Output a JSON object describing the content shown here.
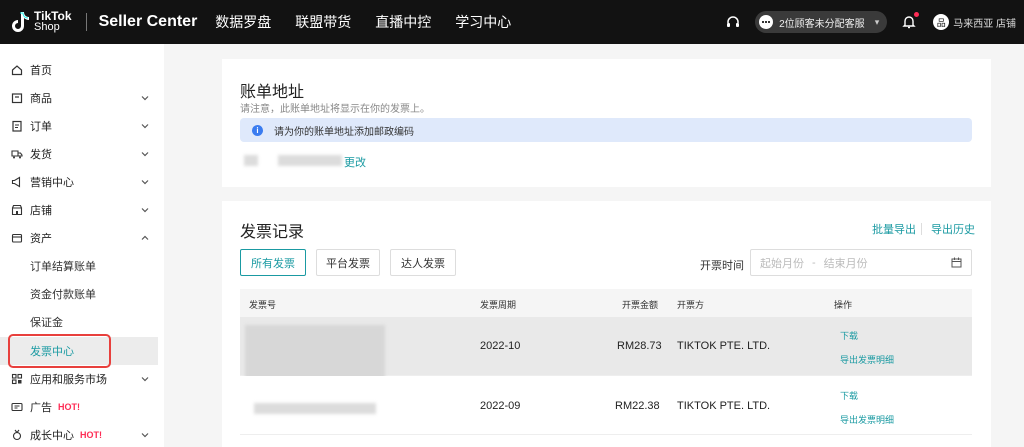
{
  "topbar": {
    "logo_main": "TikTok",
    "logo_sub": "Shop",
    "brand": "Seller Center",
    "nav": [
      "数据罗盘",
      "联盟带货",
      "直播中控",
      "学习中心"
    ],
    "cs_status": "2位顾客未分配客服",
    "shop_avatar_glyph": "品",
    "shop_name": "马来西亚 店铺"
  },
  "sidebar": {
    "items": [
      {
        "label": "首页",
        "icon": "home-icon"
      },
      {
        "label": "商品",
        "icon": "product-box-icon"
      },
      {
        "label": "订单",
        "icon": "order-clipboard-icon"
      },
      {
        "label": "发货",
        "icon": "delivery-truck-icon"
      },
      {
        "label": "营销中心",
        "icon": "megaphone-icon"
      },
      {
        "label": "店铺",
        "icon": "store-icon"
      },
      {
        "label": "资产",
        "icon": "wallet-icon"
      }
    ],
    "sub_items": [
      "订单结算账单",
      "资金付款账单",
      "保证金",
      "发票中心"
    ],
    "bottom_items": [
      {
        "label": "应用和服务市场",
        "icon": "apps-grid-icon",
        "hot": ""
      },
      {
        "label": "广告",
        "icon": "ads-screen-icon",
        "hot": "HOT!"
      },
      {
        "label": "成长中心",
        "icon": "growth-medal-icon",
        "hot": "HOT!"
      }
    ]
  },
  "billing": {
    "title": "账单地址",
    "subtitle": "请注意，此账单地址将显示在你的发票上。",
    "info": "请为你的账单地址添加邮政编码",
    "edit_link": "更改"
  },
  "invoices": {
    "title": "发票记录",
    "bulk_export": "批量导出",
    "export_history": "导出历史",
    "tabs": [
      "所有发票",
      "平台发票",
      "达人发票"
    ],
    "date_label": "开票时间",
    "date_start_placeholder": "起始月份",
    "date_sep": "-",
    "date_end_placeholder": "结束月份",
    "columns": [
      "发票号",
      "发票周期",
      "开票金额",
      "开票方",
      "操作"
    ],
    "rows": [
      {
        "period": "2022-10",
        "amount": "RM28.73",
        "issuer": "TIKTOK PTE. LTD.",
        "action1": "下载",
        "action2": "导出发票明细"
      },
      {
        "period": "2022-09",
        "amount": "RM22.38",
        "issuer": "TIKTOK PTE. LTD.",
        "action1": "下载",
        "action2": "导出发票明细"
      }
    ]
  },
  "colors": {
    "accent": "#1a9aa2",
    "hot": "#fe2c55",
    "topbar": "#121212",
    "info_bg": "#dfe9fb",
    "highlight_box": "#e8403d"
  }
}
